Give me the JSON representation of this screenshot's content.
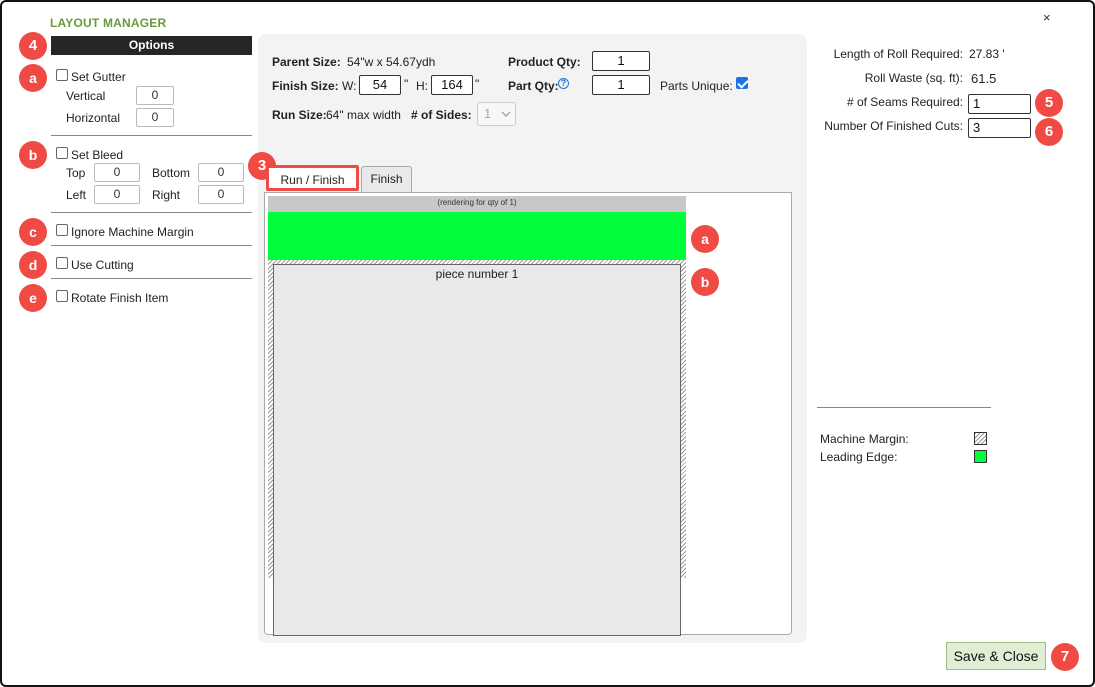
{
  "window": {
    "title": "LAYOUT MANAGER",
    "close_label": "×"
  },
  "options": {
    "header": "Options",
    "gutter": {
      "label": "Set Gutter",
      "checked": false,
      "vertical_label": "Vertical",
      "vertical_value": "0",
      "horizontal_label": "Horizontal",
      "horizontal_value": "0"
    },
    "bleed": {
      "label": "Set Bleed",
      "checked": false,
      "top_label": "Top",
      "top_value": "0",
      "bottom_label": "Bottom",
      "bottom_value": "0",
      "left_label": "Left",
      "left_value": "0",
      "right_label": "Right",
      "right_value": "0"
    },
    "ignore_margin": {
      "label": "Ignore Machine Margin",
      "checked": false
    },
    "use_cutting": {
      "label": "Use Cutting",
      "checked": false
    },
    "rotate_finish": {
      "label": "Rotate Finish Item",
      "checked": false
    }
  },
  "badges": {
    "b3": "3",
    "b4": "4",
    "b5": "5",
    "b6": "6",
    "b7": "7",
    "a": "a",
    "b": "b",
    "c": "c",
    "d": "d",
    "e": "e"
  },
  "center": {
    "parent_size_label": "Parent Size:",
    "parent_size_value": "54\"w x 54.67ydh",
    "finish_size_label": "Finish Size:",
    "w_label": "W:",
    "w_value": "54",
    "inch_mark": "\"",
    "h_label": "H:",
    "h_value": "164",
    "run_size_label": "Run Size:",
    "run_size_value": "64\" max width",
    "product_qty_label": "Product Qty:",
    "product_qty_value": "1",
    "part_qty_label": "Part Qty:",
    "part_qty_value": "1",
    "help_icon": "?",
    "parts_unique_label": "Parts Unique:",
    "parts_unique_checked": true,
    "sides_label": "# of Sides:",
    "sides_value": "1",
    "tabs": [
      {
        "label": "Run / Finish",
        "active": true
      },
      {
        "label": "Finish",
        "active": false
      }
    ],
    "render_note": "(rendering for qty of 1)",
    "piece_label": "piece number 1"
  },
  "summary": {
    "roll_length_label": "Length of Roll Required:",
    "roll_length_value": "27.83 '",
    "roll_waste_label": "Roll Waste (sq. ft):",
    "roll_waste_value": "61.5",
    "seams_label": "# of Seams Required:",
    "seams_value": "1",
    "cuts_label": "Number Of Finished Cuts:",
    "cuts_value": "3"
  },
  "legend": {
    "machine_margin_label": "Machine Margin:",
    "leading_edge_label": "Leading Edge:",
    "leading_edge_color": "#00ff3a"
  },
  "actions": {
    "save_close_label": "Save & Close"
  }
}
